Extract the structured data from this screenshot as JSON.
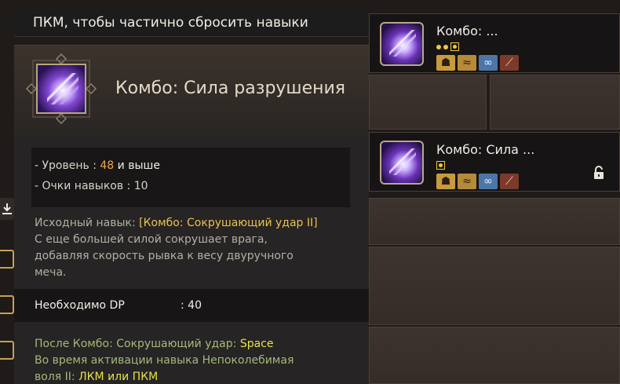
{
  "hint": {
    "text": "ПКМ, чтобы частично сбросить навыки"
  },
  "tooltip": {
    "title": "Комбо: Сила разрушения",
    "requirements": {
      "level_prefix": "- Уровень :",
      "level_value": "48",
      "level_suffix": "и выше",
      "points_label": "- Очки навыков : 10"
    },
    "description": {
      "base_label": "Исходный навык:",
      "base_skill": "[Комбо: Сокрушающий удар II]",
      "text_line1": "С еще большей силой сокрушает врага,",
      "text_line2": "добавляя скорость рывка к весу двуручного",
      "text_line3": "меча."
    },
    "dp": {
      "label": "Необходимо DP",
      "value": ": 40"
    },
    "combo": {
      "line1_text": "После Комбо: Сокрушающий удар:",
      "line1_key": "Space",
      "line2_text": "Во время активации навыка Непоколебимая",
      "line3_text": "воля II:",
      "line3_key": "ЛКМ или ПКМ"
    }
  },
  "skill_cards": [
    {
      "name": "Комбо: ...",
      "icons": [
        "helmet-icon",
        "dash-icon",
        "chain-icon",
        "claw-icon"
      ]
    },
    {
      "name": "Комбо: Сила ...",
      "icons": [
        "helmet-icon",
        "dash-icon",
        "chain-icon",
        "claw-icon"
      ],
      "locked": true
    }
  ],
  "colors": {
    "level_highlight": "#f0a84a",
    "base_skill": "#e8c250",
    "combo_text": "#a6b87a",
    "combo_key": "#e6e24a"
  }
}
